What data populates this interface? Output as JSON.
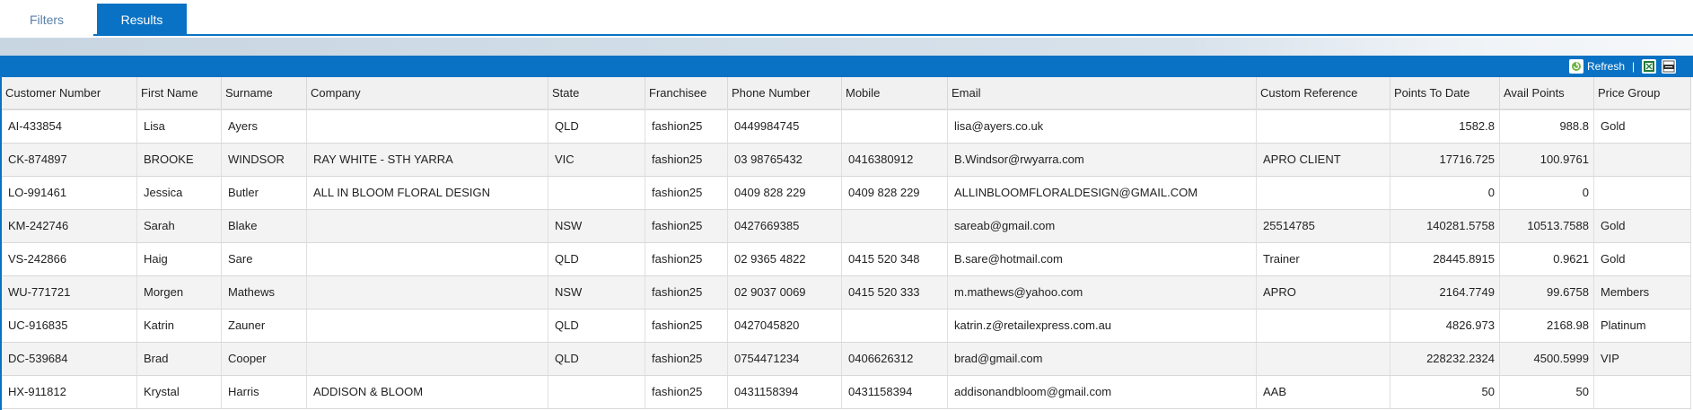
{
  "tabs": {
    "filters": "Filters",
    "results": "Results"
  },
  "toolbar": {
    "refresh_label": "Refresh",
    "separator": "|",
    "refresh_icon": "refresh-icon",
    "excel_icon": "excel-export-icon",
    "csv_icon": "csv-export-icon"
  },
  "colors": {
    "accent": "#0a72c4",
    "header_bg": "#f1f1f1",
    "alt_row": "#f3f3f3"
  },
  "columns": [
    "Customer Number",
    "First Name",
    "Surname",
    "Company",
    "State",
    "Franchisee",
    "Phone Number",
    "Mobile",
    "Email",
    "Custom Reference",
    "Points To Date",
    "Avail Points",
    "Price Group"
  ],
  "rows": [
    [
      "AI-433854",
      "Lisa",
      "Ayers",
      "",
      "QLD",
      "fashion25",
      "0449984745",
      "",
      "lisa@ayers.co.uk",
      "",
      "1582.8",
      "988.8",
      "Gold"
    ],
    [
      "CK-874897",
      "BROOKE",
      "WINDSOR",
      "RAY WHITE - STH YARRA",
      "VIC",
      "fashion25",
      "03 98765432",
      "0416380912",
      "B.Windsor@rwyarra.com",
      "APRO CLIENT",
      "17716.725",
      "100.9761",
      ""
    ],
    [
      "LO-991461",
      "Jessica",
      "Butler",
      "ALL IN BLOOM FLORAL DESIGN",
      "",
      "fashion25",
      "0409 828 229",
      "0409 828 229",
      "ALLINBLOOMFLORALDESIGN@GMAIL.COM",
      "",
      "0",
      "0",
      ""
    ],
    [
      "KM-242746",
      "Sarah",
      "Blake",
      "",
      "NSW",
      "fashion25",
      "0427669385",
      "",
      "sareab@gmail.com",
      "25514785",
      "140281.5758",
      "10513.7588",
      "Gold"
    ],
    [
      "VS-242866",
      "Haig",
      "Sare",
      "",
      "QLD",
      "fashion25",
      "02 9365 4822",
      "0415 520 348",
      "B.sare@hotmail.com",
      "Trainer",
      "28445.8915",
      "0.9621",
      "Gold"
    ],
    [
      "WU-771721",
      "Morgen",
      "Mathews",
      "",
      "NSW",
      "fashion25",
      "02 9037 0069",
      "0415 520 333",
      "m.mathews@yahoo.com",
      "APRO",
      "2164.7749",
      "99.6758",
      "Members"
    ],
    [
      "UC-916835",
      "Katrin",
      "Zauner",
      "",
      "QLD",
      "fashion25",
      "0427045820",
      "",
      "katrin.z@retailexpress.com.au",
      "",
      "4826.973",
      "2168.98",
      "Platinum"
    ],
    [
      "DC-539684",
      "Brad",
      "Cooper",
      "",
      "QLD",
      "fashion25",
      "0754471234",
      "0406626312",
      "brad@gmail.com",
      "",
      "228232.2324",
      "4500.5999",
      "VIP"
    ],
    [
      "HX-911812",
      "Krystal",
      "Harris",
      "ADDISON & BLOOM",
      "",
      "fashion25",
      "0431158394",
      "0431158394",
      "addisonandbloom@gmail.com",
      "AAB",
      "50",
      "50",
      ""
    ]
  ]
}
